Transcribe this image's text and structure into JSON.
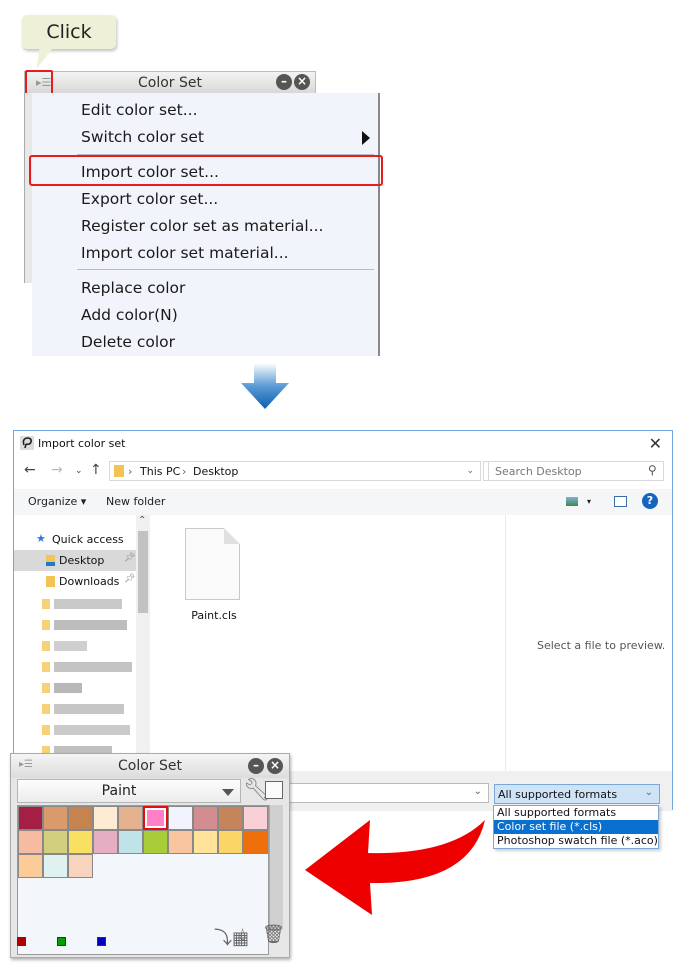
{
  "callout": {
    "label": "Click"
  },
  "color_set_top": {
    "title": "Color Set",
    "menu_icon": "panel-menu-icon",
    "minimize_icon": "minimize-icon",
    "close_icon": "close-icon"
  },
  "context_menu": {
    "items": [
      {
        "label": "Edit color set..."
      },
      {
        "label": "Switch color set",
        "submenu": true
      },
      {
        "label": "Import color set...",
        "highlighted": true
      },
      {
        "label": "Export color set..."
      },
      {
        "label": "Register color set as material..."
      },
      {
        "label": "Import color set material..."
      },
      {
        "label": "Replace color"
      },
      {
        "label": "Add color(N)"
      },
      {
        "label": "Delete color"
      }
    ]
  },
  "dialog": {
    "title": "Import color set",
    "breadcrumb": [
      "This PC",
      "Desktop"
    ],
    "search_placeholder": "Search Desktop",
    "toolbar": {
      "organize": "Organize",
      "new_folder": "New folder"
    },
    "nav": {
      "quick_access": "Quick access",
      "items": [
        {
          "label": "Desktop",
          "selected": true
        },
        {
          "label": "Downloads"
        }
      ]
    },
    "files": [
      {
        "name": "Paint.cls"
      }
    ],
    "preview_text": "Select a file to preview.",
    "filename_value": "",
    "format_selected": "All supported formats",
    "format_options": [
      {
        "label": "All supported formats"
      },
      {
        "label": "Color set file (*.cls)",
        "highlighted": true
      },
      {
        "label": "Photoshop swatch file (*.aco)"
      }
    ]
  },
  "color_set_bottom": {
    "title": "Color Set",
    "selected_set": "Paint",
    "swatches": [
      "#a51f45",
      "#d99a6c",
      "#c5834f",
      "#fdebd3",
      "#e6b18e",
      "#ff7fc8",
      "#f1f4fc",
      "#d38c8f",
      "#c5855b",
      "#f9d0d6",
      "#f7bba1",
      "#d2d07e",
      "#f9e063",
      "#e5aec2",
      "#c0e2e9",
      "#a8cd38",
      "#f9c59f",
      "#ffe39a",
      "#fbd565",
      "#ee6f0c",
      "#fbcb98",
      "#dff2ef",
      "#f8d3bd"
    ],
    "selected_swatch_index": 5,
    "recent_colors": [
      "#b00000",
      "#00a000",
      "#0000c0"
    ]
  }
}
